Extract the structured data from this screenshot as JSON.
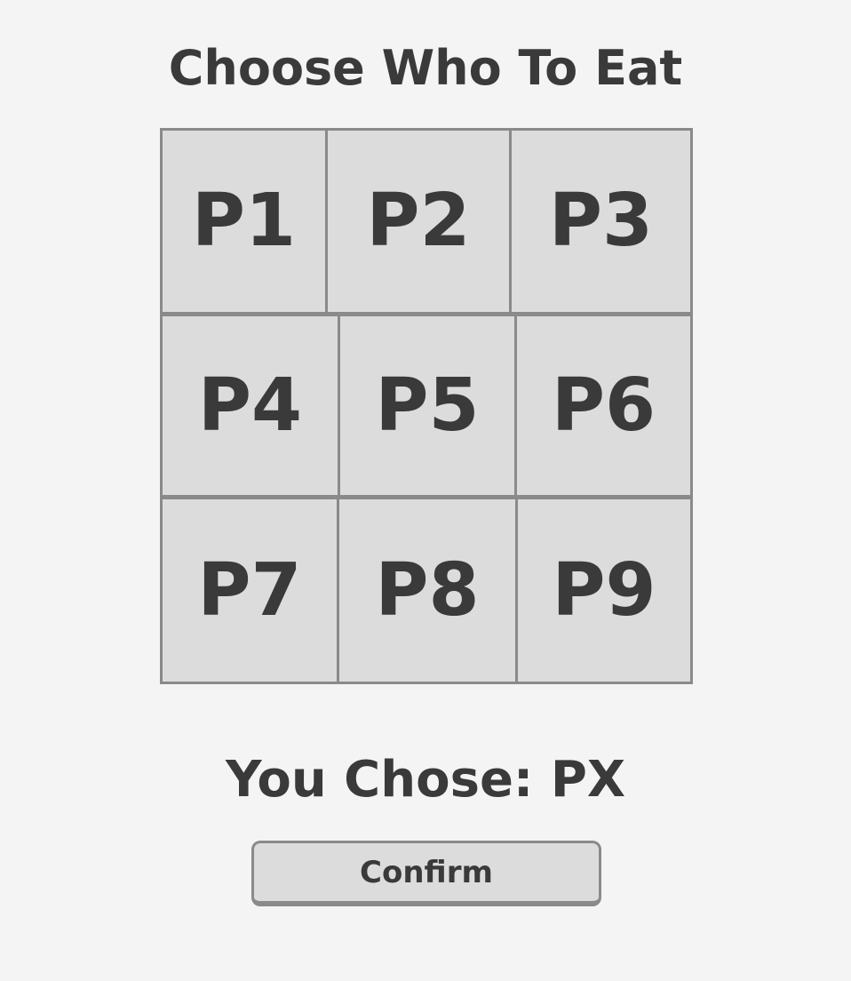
{
  "title": "Choose Who To Eat",
  "grid": {
    "rows": [
      [
        "P1",
        "P2",
        "P3"
      ],
      [
        "P4",
        "P5",
        "P6"
      ],
      [
        "P7",
        "P8",
        "P9"
      ]
    ]
  },
  "selection": {
    "text": "You Chose: PX"
  },
  "confirm_label": "Confirm",
  "colors": {
    "background": "#f4f4f4",
    "cell": "#dcdcdc",
    "border": "#8a8a8a",
    "text": "#3a3a3a"
  }
}
